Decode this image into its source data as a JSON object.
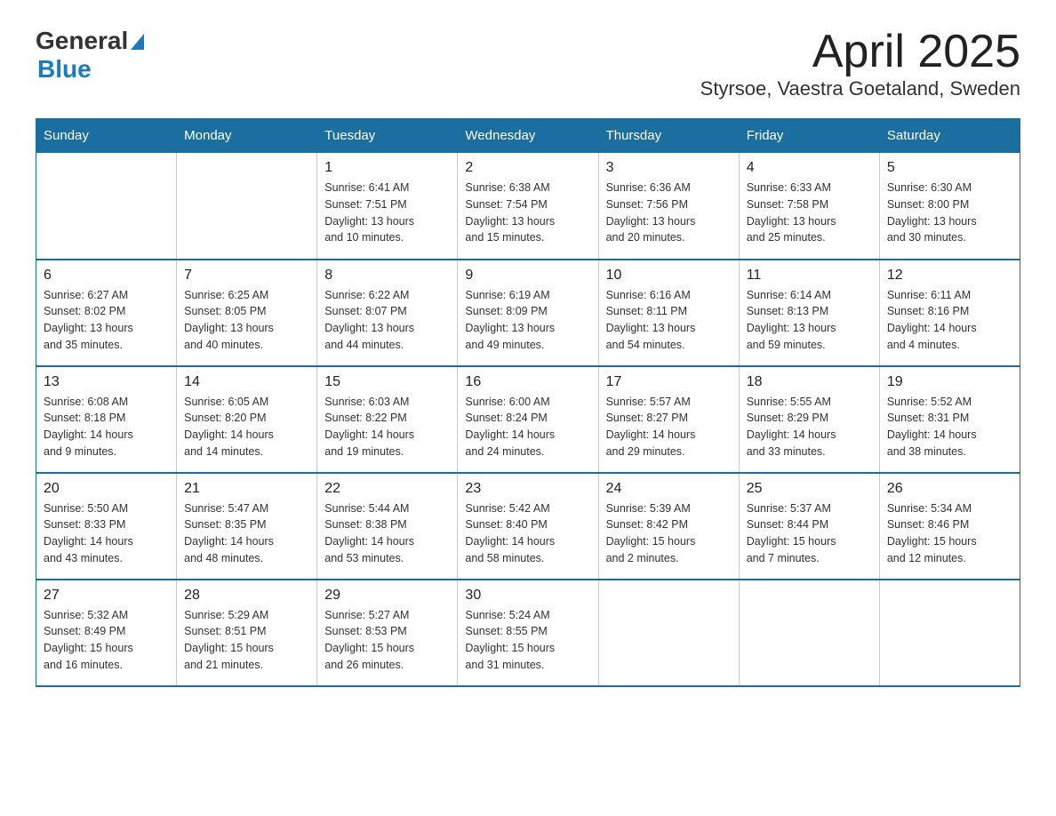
{
  "header": {
    "month_title": "April 2025",
    "location": "Styrsoe, Vaestra Goetaland, Sweden",
    "logo_general": "General",
    "logo_blue": "Blue"
  },
  "calendar": {
    "days_of_week": [
      "Sunday",
      "Monday",
      "Tuesday",
      "Wednesday",
      "Thursday",
      "Friday",
      "Saturday"
    ],
    "weeks": [
      [
        {
          "day": "",
          "info": ""
        },
        {
          "day": "",
          "info": ""
        },
        {
          "day": "1",
          "info": "Sunrise: 6:41 AM\nSunset: 7:51 PM\nDaylight: 13 hours\nand 10 minutes."
        },
        {
          "day": "2",
          "info": "Sunrise: 6:38 AM\nSunset: 7:54 PM\nDaylight: 13 hours\nand 15 minutes."
        },
        {
          "day": "3",
          "info": "Sunrise: 6:36 AM\nSunset: 7:56 PM\nDaylight: 13 hours\nand 20 minutes."
        },
        {
          "day": "4",
          "info": "Sunrise: 6:33 AM\nSunset: 7:58 PM\nDaylight: 13 hours\nand 25 minutes."
        },
        {
          "day": "5",
          "info": "Sunrise: 6:30 AM\nSunset: 8:00 PM\nDaylight: 13 hours\nand 30 minutes."
        }
      ],
      [
        {
          "day": "6",
          "info": "Sunrise: 6:27 AM\nSunset: 8:02 PM\nDaylight: 13 hours\nand 35 minutes."
        },
        {
          "day": "7",
          "info": "Sunrise: 6:25 AM\nSunset: 8:05 PM\nDaylight: 13 hours\nand 40 minutes."
        },
        {
          "day": "8",
          "info": "Sunrise: 6:22 AM\nSunset: 8:07 PM\nDaylight: 13 hours\nand 44 minutes."
        },
        {
          "day": "9",
          "info": "Sunrise: 6:19 AM\nSunset: 8:09 PM\nDaylight: 13 hours\nand 49 minutes."
        },
        {
          "day": "10",
          "info": "Sunrise: 6:16 AM\nSunset: 8:11 PM\nDaylight: 13 hours\nand 54 minutes."
        },
        {
          "day": "11",
          "info": "Sunrise: 6:14 AM\nSunset: 8:13 PM\nDaylight: 13 hours\nand 59 minutes."
        },
        {
          "day": "12",
          "info": "Sunrise: 6:11 AM\nSunset: 8:16 PM\nDaylight: 14 hours\nand 4 minutes."
        }
      ],
      [
        {
          "day": "13",
          "info": "Sunrise: 6:08 AM\nSunset: 8:18 PM\nDaylight: 14 hours\nand 9 minutes."
        },
        {
          "day": "14",
          "info": "Sunrise: 6:05 AM\nSunset: 8:20 PM\nDaylight: 14 hours\nand 14 minutes."
        },
        {
          "day": "15",
          "info": "Sunrise: 6:03 AM\nSunset: 8:22 PM\nDaylight: 14 hours\nand 19 minutes."
        },
        {
          "day": "16",
          "info": "Sunrise: 6:00 AM\nSunset: 8:24 PM\nDaylight: 14 hours\nand 24 minutes."
        },
        {
          "day": "17",
          "info": "Sunrise: 5:57 AM\nSunset: 8:27 PM\nDaylight: 14 hours\nand 29 minutes."
        },
        {
          "day": "18",
          "info": "Sunrise: 5:55 AM\nSunset: 8:29 PM\nDaylight: 14 hours\nand 33 minutes."
        },
        {
          "day": "19",
          "info": "Sunrise: 5:52 AM\nSunset: 8:31 PM\nDaylight: 14 hours\nand 38 minutes."
        }
      ],
      [
        {
          "day": "20",
          "info": "Sunrise: 5:50 AM\nSunset: 8:33 PM\nDaylight: 14 hours\nand 43 minutes."
        },
        {
          "day": "21",
          "info": "Sunrise: 5:47 AM\nSunset: 8:35 PM\nDaylight: 14 hours\nand 48 minutes."
        },
        {
          "day": "22",
          "info": "Sunrise: 5:44 AM\nSunset: 8:38 PM\nDaylight: 14 hours\nand 53 minutes."
        },
        {
          "day": "23",
          "info": "Sunrise: 5:42 AM\nSunset: 8:40 PM\nDaylight: 14 hours\nand 58 minutes."
        },
        {
          "day": "24",
          "info": "Sunrise: 5:39 AM\nSunset: 8:42 PM\nDaylight: 15 hours\nand 2 minutes."
        },
        {
          "day": "25",
          "info": "Sunrise: 5:37 AM\nSunset: 8:44 PM\nDaylight: 15 hours\nand 7 minutes."
        },
        {
          "day": "26",
          "info": "Sunrise: 5:34 AM\nSunset: 8:46 PM\nDaylight: 15 hours\nand 12 minutes."
        }
      ],
      [
        {
          "day": "27",
          "info": "Sunrise: 5:32 AM\nSunset: 8:49 PM\nDaylight: 15 hours\nand 16 minutes."
        },
        {
          "day": "28",
          "info": "Sunrise: 5:29 AM\nSunset: 8:51 PM\nDaylight: 15 hours\nand 21 minutes."
        },
        {
          "day": "29",
          "info": "Sunrise: 5:27 AM\nSunset: 8:53 PM\nDaylight: 15 hours\nand 26 minutes."
        },
        {
          "day": "30",
          "info": "Sunrise: 5:24 AM\nSunset: 8:55 PM\nDaylight: 15 hours\nand 31 minutes."
        },
        {
          "day": "",
          "info": ""
        },
        {
          "day": "",
          "info": ""
        },
        {
          "day": "",
          "info": ""
        }
      ]
    ]
  }
}
